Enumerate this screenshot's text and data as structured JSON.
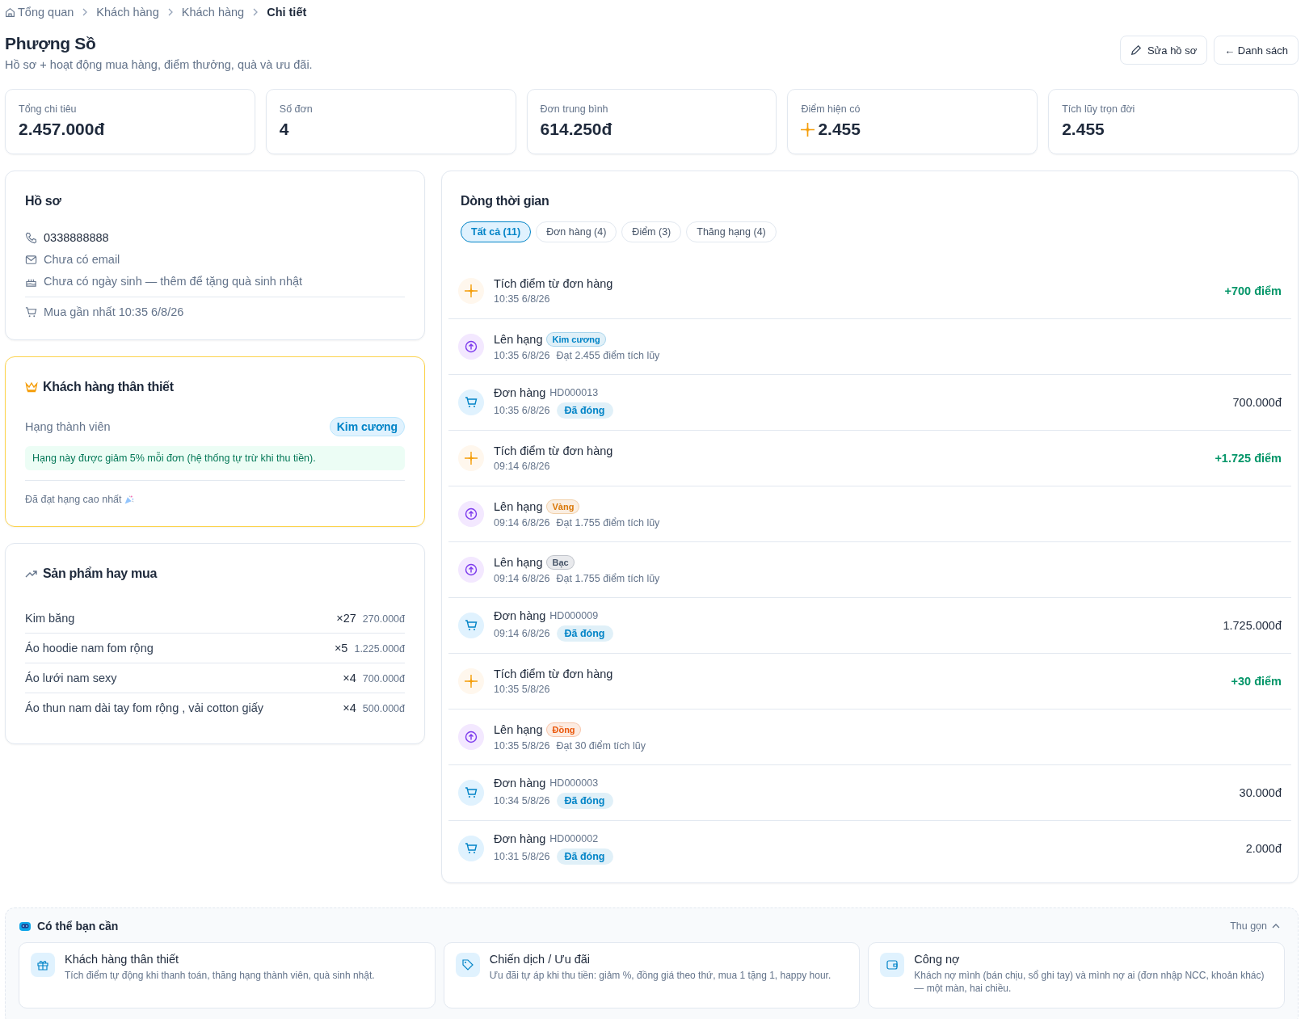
{
  "breadcrumb": [
    {
      "label": "Tổng quan",
      "kind": "home"
    },
    {
      "label": "Khách hàng"
    },
    {
      "label": "Khách hàng"
    },
    {
      "label": "Chi tiết",
      "current": true
    }
  ],
  "header": {
    "title": "Phượng Sồ",
    "subtitle": "Hồ sơ + hoạt động mua hàng, điểm thưởng, quà và ưu đãi.",
    "buttons": [
      {
        "label": "Sửa hồ sơ",
        "kind": "edit"
      },
      {
        "label": "← Danh sách",
        "kind": "plain"
      }
    ]
  },
  "stats": [
    {
      "label": "Tổng chi tiêu",
      "value": "2.457.000đ"
    },
    {
      "label": "Số đơn",
      "value": "4"
    },
    {
      "label": "Đơn trung bình",
      "value": "614.250đ"
    },
    {
      "label": "Điểm hiện có",
      "value": "2.455",
      "kind": "points"
    },
    {
      "label": "Tích lũy trọn đời",
      "value": "2.455"
    }
  ],
  "profile": {
    "title": "Hồ sơ",
    "items": [
      {
        "kind": "phone",
        "text": "0338888888"
      },
      {
        "kind": "email",
        "text": "Chưa có email"
      },
      {
        "kind": "birthday",
        "text": "Chưa có ngày sinh — thêm để tặng quà sinh nhật"
      },
      {
        "kind": "cart",
        "text": "Mua gần nhất 10:35 6/8/26"
      }
    ]
  },
  "loyalty": {
    "title": "Khách hàng thân thiết",
    "rank_label": "Hạng thành viên",
    "rank": "Kim cương",
    "note": "Hạng này được giảm 5% mỗi đơn (hệ thống tự trừ khi thu tiền).",
    "footer": "Đã đạt hạng cao nhất"
  },
  "top_products": {
    "title": "Sản phẩm hay mua",
    "rows": [
      {
        "name": "Kim băng",
        "qty": "×27",
        "amount": "270.000đ"
      },
      {
        "name": "Áo hoodie nam fom rộng",
        "qty": "×5",
        "amount": "1.225.000đ"
      },
      {
        "name": "Áo lưới nam sexy",
        "qty": "×4",
        "amount": "700.000đ"
      },
      {
        "name": "Áo thun nam dài tay fom rộng , vải cotton giấy",
        "qty": "×4",
        "amount": "500.000đ"
      }
    ]
  },
  "timeline": {
    "title": "Dòng thời gian",
    "filters": [
      {
        "label": "Tất cả (11)",
        "selected": true
      },
      {
        "label": "Đơn hàng (4)",
        "selected": false
      },
      {
        "label": "Điểm (3)",
        "selected": false
      },
      {
        "label": "Thăng hạng (4)",
        "selected": false
      }
    ],
    "items": [
      {
        "kind": "points",
        "title": "Tích điểm từ đơn hàng",
        "time": "10:35 6/8/26",
        "amount": "+700 điểm"
      },
      {
        "kind": "tier",
        "title": "Lên hạng",
        "badge": {
          "text": "Kim cương",
          "color": "#0284c7"
        },
        "time": "10:35 6/8/26",
        "detail": "Đạt 2.455 điểm tích lũy"
      },
      {
        "kind": "order",
        "title": "Đơn hàng",
        "code": "HD000013",
        "time": "10:35 6/8/26",
        "badge": {
          "text": "Đã đóng",
          "color": "#0284c7"
        },
        "amount": "700.000đ"
      },
      {
        "kind": "points",
        "title": "Tích điểm từ đơn hàng",
        "time": "09:14 6/8/26",
        "amount": "+1.725 điểm"
      },
      {
        "kind": "tier",
        "title": "Lên hạng",
        "badge": {
          "text": "Vàng",
          "color": "#d97706"
        },
        "time": "09:14 6/8/26",
        "detail": "Đạt 1.755 điểm tích lũy"
      },
      {
        "kind": "tier",
        "title": "Lên hạng",
        "badge": {
          "text": "Bạc",
          "color": "#475569"
        },
        "time": "09:14 6/8/26",
        "detail": "Đạt 1.755 điểm tích lũy"
      },
      {
        "kind": "order",
        "title": "Đơn hàng",
        "code": "HD000009",
        "time": "09:14 6/8/26",
        "badge": {
          "text": "Đã đóng",
          "color": "#0284c7"
        },
        "amount": "1.725.000đ"
      },
      {
        "kind": "points",
        "title": "Tích điểm từ đơn hàng",
        "time": "10:35 5/8/26",
        "amount": "+30 điểm"
      },
      {
        "kind": "tier",
        "title": "Lên hạng",
        "badge": {
          "text": "Đồng",
          "color": "#ea580c"
        },
        "time": "10:35 5/8/26",
        "detail": "Đạt 30 điểm tích lũy"
      },
      {
        "kind": "order",
        "title": "Đơn hàng",
        "code": "HD000003",
        "time": "10:34 5/8/26",
        "badge": {
          "text": "Đã đóng",
          "color": "#0284c7"
        },
        "amount": "30.000đ"
      },
      {
        "kind": "order",
        "title": "Đơn hàng",
        "code": "HD000002",
        "time": "10:31 5/8/26",
        "badge": {
          "text": "Đã đóng",
          "color": "#0284c7"
        },
        "amount": "2.000đ"
      }
    ]
  },
  "suggestions": {
    "title": "Có thể bạn cần",
    "collapse": "Thu gọn",
    "expanded": true,
    "cards": [
      {
        "kind": "gift",
        "title": "Khách hàng thân thiết",
        "text": "Tích điểm tự động khi thanh toán, thăng hạng thành viên, quà sinh nhật."
      },
      {
        "kind": "tag",
        "title": "Chiến dịch / Ưu đãi",
        "text": "Ưu đãi tự áp khi thu tiền: giảm %, đồng giá theo thứ, mua 1 tặng 1, happy hour."
      },
      {
        "kind": "wallet",
        "title": "Công nợ",
        "text": "Khách nợ mình (bán chịu, sổ ghi tay) và mình nợ ai (đơn nhập NCC, khoản khác) — một màn, hai chiều."
      }
    ]
  }
}
